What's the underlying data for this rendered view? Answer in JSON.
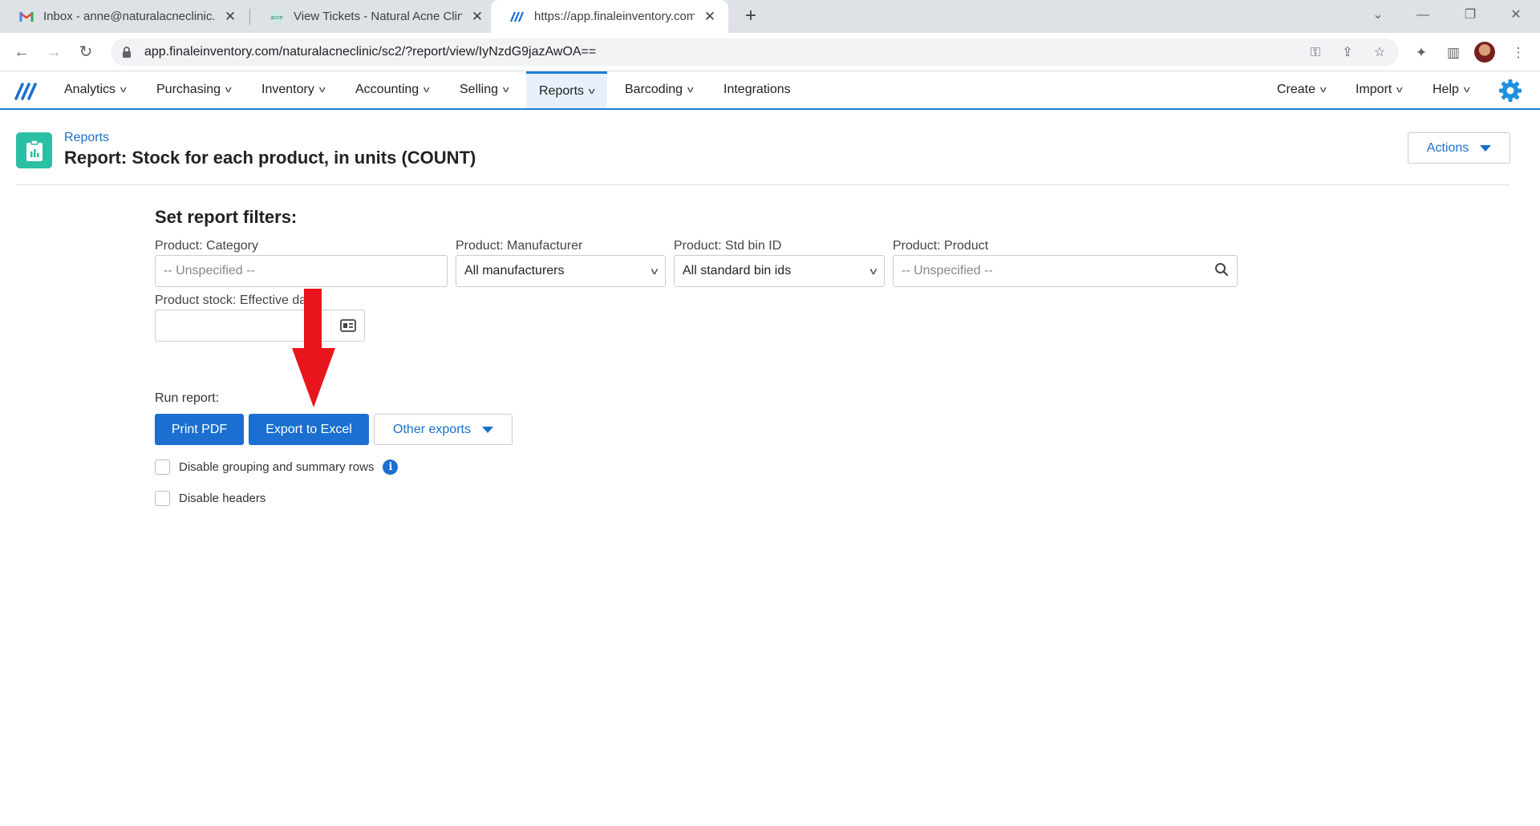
{
  "browser": {
    "tabs": [
      {
        "title": "Inbox - anne@naturalacneclinic.c",
        "favicon": "gmail-icon"
      },
      {
        "title": "View Tickets - Natural Acne Clinic",
        "favicon": "clinic-icon"
      },
      {
        "title": "https://app.finaleinventory.com/r",
        "favicon": "finale-icon"
      }
    ],
    "url": "app.finaleinventory.com/naturalacneclinic/sc2/?report/view/IyNzdG9jazAwOA=="
  },
  "nav": {
    "left": [
      {
        "label": "Analytics",
        "dropdown": true
      },
      {
        "label": "Purchasing",
        "dropdown": true
      },
      {
        "label": "Inventory",
        "dropdown": true
      },
      {
        "label": "Accounting",
        "dropdown": true
      },
      {
        "label": "Selling",
        "dropdown": true
      },
      {
        "label": "Reports",
        "dropdown": true,
        "active": true
      },
      {
        "label": "Barcoding",
        "dropdown": true
      },
      {
        "label": "Integrations",
        "dropdown": false
      }
    ],
    "right": [
      {
        "label": "Create"
      },
      {
        "label": "Import"
      },
      {
        "label": "Help"
      }
    ]
  },
  "page": {
    "breadcrumb": "Reports",
    "title": "Report: Stock for each product, in units (COUNT)",
    "actions_label": "Actions"
  },
  "filters": {
    "heading": "Set report filters:",
    "category": {
      "label": "Product: Category",
      "placeholder": "-- Unspecified --"
    },
    "manufacturer": {
      "label": "Product: Manufacturer",
      "value": "All manufacturers"
    },
    "bin": {
      "label": "Product: Std bin ID",
      "value": "All standard bin ids"
    },
    "product": {
      "label": "Product: Product",
      "placeholder": "-- Unspecified --"
    },
    "effective_date": {
      "label": "Product stock: Effective date",
      "value": ""
    }
  },
  "run": {
    "label": "Run report:",
    "print_pdf": "Print PDF",
    "export_excel": "Export to Excel",
    "other_exports": "Other exports",
    "disable_grouping": "Disable grouping and summary rows",
    "disable_headers": "Disable headers"
  },
  "colors": {
    "primary": "#1a6fd0",
    "nav_accent": "#1a7fd4",
    "page_icon": "#2bbfa4",
    "annotation_arrow": "#e8151c"
  }
}
